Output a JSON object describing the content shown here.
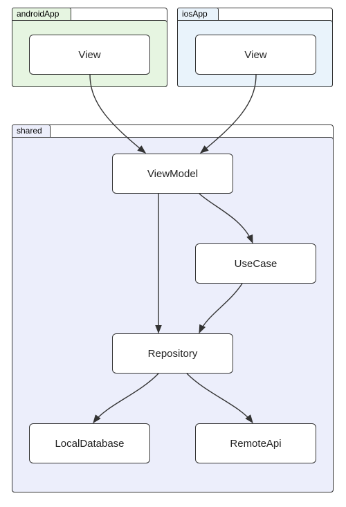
{
  "containers": {
    "android": {
      "label": "androidApp",
      "fill": "#e6f5e1"
    },
    "ios": {
      "label": "iosApp",
      "fill": "#e9f3fb"
    },
    "shared": {
      "label": "shared",
      "fill": "#eceefb"
    }
  },
  "nodes": {
    "androidView": "View",
    "iosView": "View",
    "viewModel": "ViewModel",
    "useCase": "UseCase",
    "repository": "Repository",
    "localDatabase": "LocalDatabase",
    "remoteApi": "RemoteApi"
  },
  "edges": [
    {
      "from": "androidView",
      "to": "viewModel"
    },
    {
      "from": "iosView",
      "to": "viewModel"
    },
    {
      "from": "viewModel",
      "to": "repository"
    },
    {
      "from": "viewModel",
      "to": "useCase"
    },
    {
      "from": "useCase",
      "to": "repository"
    },
    {
      "from": "repository",
      "to": "localDatabase"
    },
    {
      "from": "repository",
      "to": "remoteApi"
    }
  ]
}
